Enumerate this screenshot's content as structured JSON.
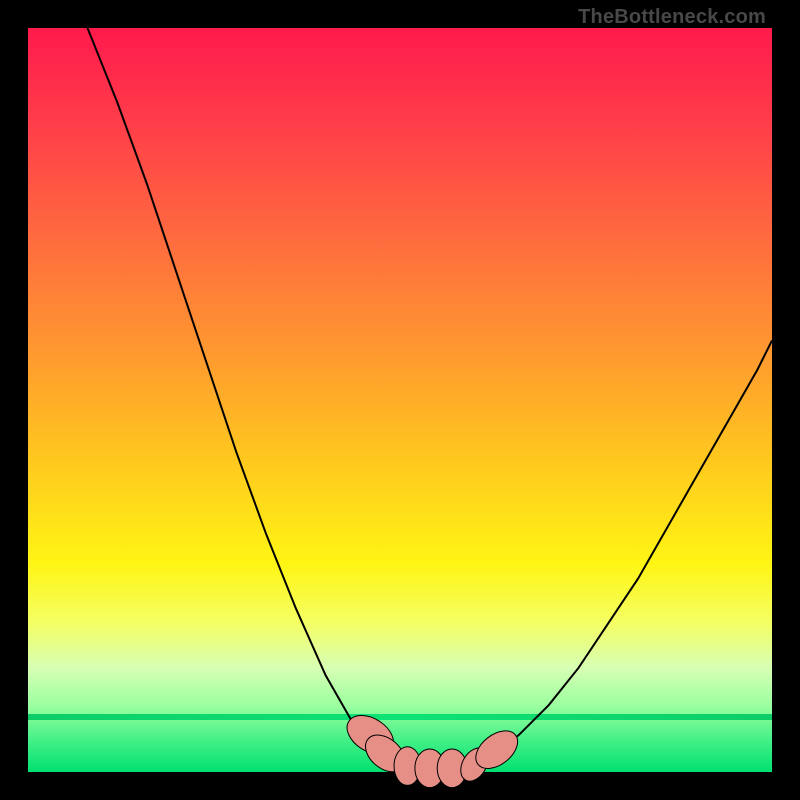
{
  "watermark": "TheBottleneck.com",
  "colors": {
    "curve_stroke": "#000000",
    "marker_fill": "#e58f87",
    "marker_stroke": "#000000"
  },
  "chart_data": {
    "type": "line",
    "title": "",
    "xlabel": "",
    "ylabel": "",
    "xlim": [
      0,
      100
    ],
    "ylim": [
      0,
      100
    ],
    "grid": false,
    "legend": false,
    "series": [
      {
        "name": "left_branch",
        "x": [
          8,
          12,
          16,
          20,
          24,
          28,
          32,
          36,
          40,
          44,
          48,
          50
        ],
        "y": [
          100,
          90,
          79,
          67,
          55,
          43,
          32,
          22,
          13,
          6,
          2,
          1
        ]
      },
      {
        "name": "valley",
        "x": [
          50,
          52,
          54,
          56,
          58,
          60,
          62
        ],
        "y": [
          1,
          0.5,
          0.4,
          0.4,
          0.5,
          1,
          1.8
        ]
      },
      {
        "name": "right_branch",
        "x": [
          62,
          66,
          70,
          74,
          78,
          82,
          86,
          90,
          94,
          98,
          100
        ],
        "y": [
          1.8,
          5,
          9,
          14,
          20,
          26,
          33,
          40,
          47,
          54,
          58
        ]
      }
    ],
    "markers": [
      {
        "name": "left_cluster",
        "x": 46,
        "y": 5,
        "rx": 2.2,
        "ry": 3.4,
        "rot": -58
      },
      {
        "name": "left_cluster2",
        "x": 48,
        "y": 2.5,
        "rx": 2.0,
        "ry": 3.0,
        "rot": -50
      },
      {
        "name": "bottom1",
        "x": 51,
        "y": 0.8,
        "rx": 1.8,
        "ry": 2.6,
        "rot": 0
      },
      {
        "name": "bottom2",
        "x": 54,
        "y": 0.5,
        "rx": 2.0,
        "ry": 2.6,
        "rot": 0
      },
      {
        "name": "bottom3",
        "x": 57,
        "y": 0.5,
        "rx": 2.0,
        "ry": 2.6,
        "rot": 0
      },
      {
        "name": "bottom_right",
        "x": 60,
        "y": 1.0,
        "rx": 1.6,
        "ry": 2.4,
        "rot": 30
      },
      {
        "name": "right_cluster",
        "x": 63,
        "y": 3.0,
        "rx": 2.0,
        "ry": 3.2,
        "rot": 52
      }
    ]
  }
}
